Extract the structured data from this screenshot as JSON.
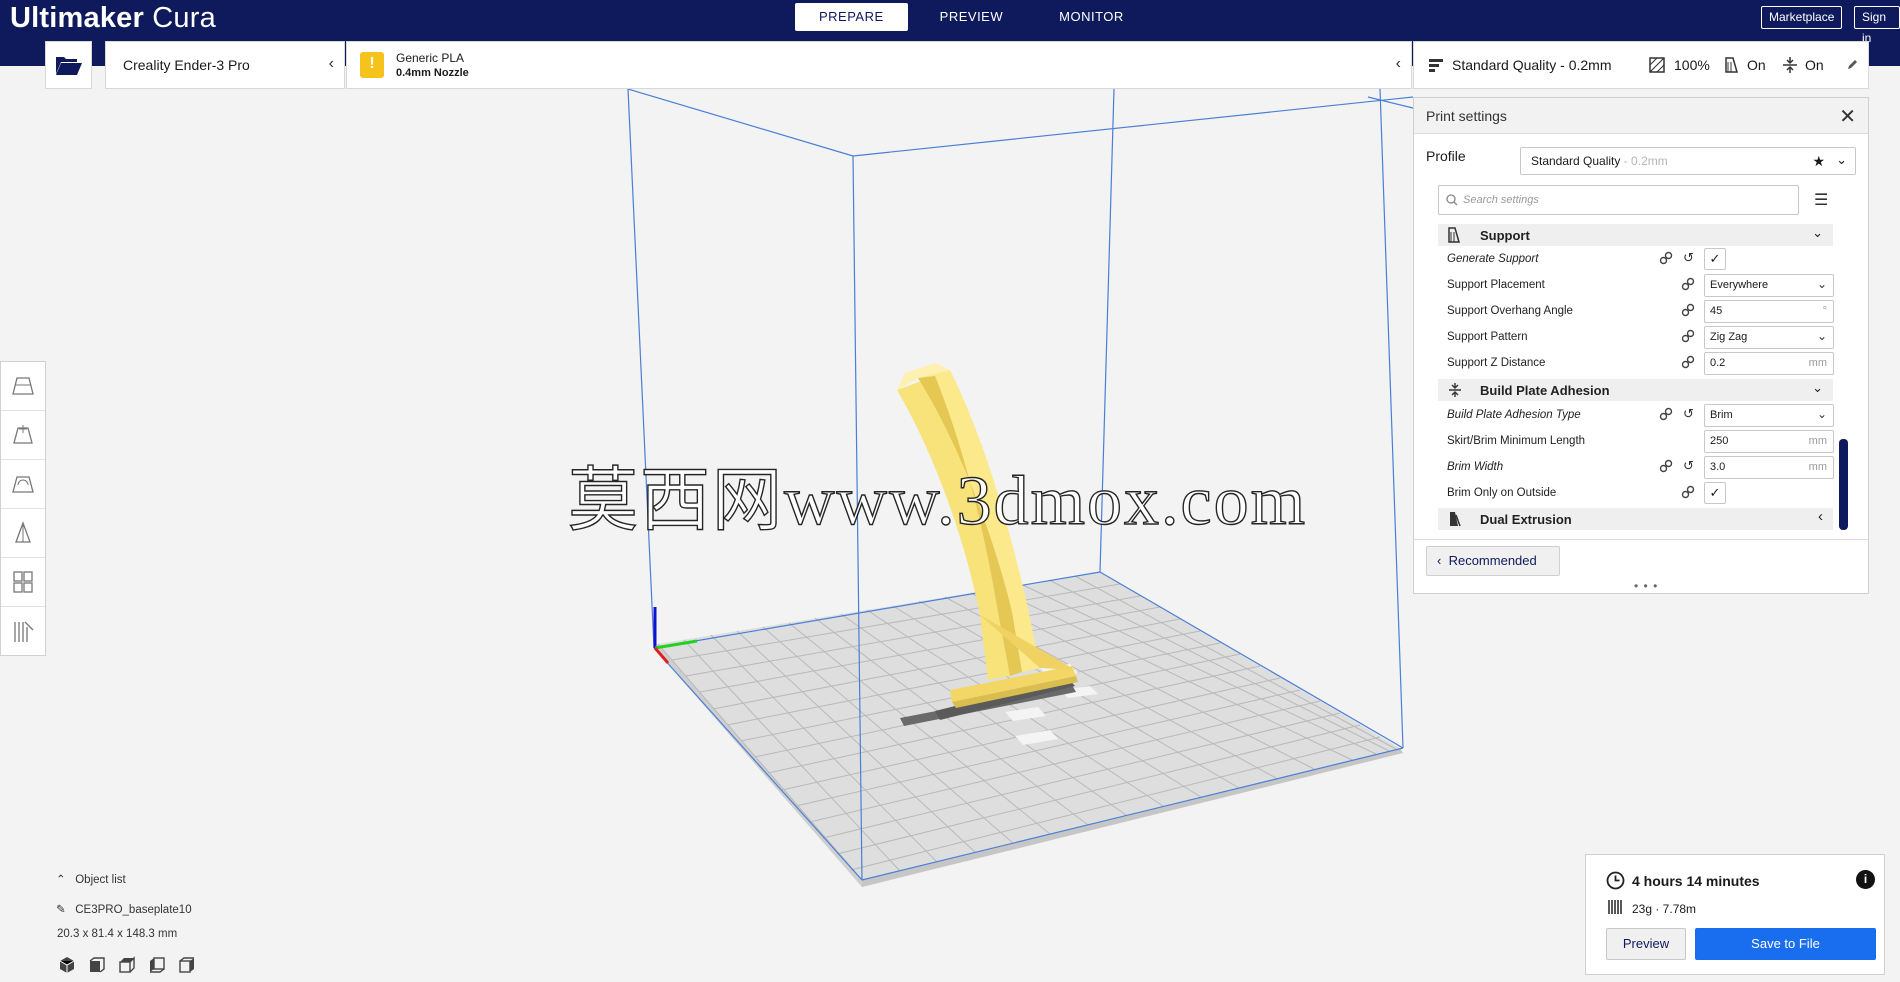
{
  "header": {
    "app_title_bold": "Ultimaker",
    "app_title_light": " Cura",
    "tabs": [
      {
        "label": "PREPARE"
      },
      {
        "label": "PREVIEW"
      },
      {
        "label": "MONITOR"
      }
    ],
    "marketplace_label": "Marketplace",
    "signin_label": "Sign in"
  },
  "printer": {
    "name": "Creality Ender-3 Pro"
  },
  "material": {
    "name": "Generic PLA",
    "nozzle": "0.4mm Nozzle",
    "warning_glyph": "!"
  },
  "print_setup": {
    "quality": "Standard Quality - 0.2mm",
    "infill": "100%",
    "support": "On",
    "adhesion": "On"
  },
  "settings_panel": {
    "title": "Print settings",
    "profile_label": "Profile",
    "profile_value": "Standard Quality",
    "profile_value_dim": " - 0.2mm",
    "search_placeholder": "Search settings",
    "categories": [
      {
        "label": "Support"
      },
      {
        "label": "Build Plate Adhesion"
      },
      {
        "label": "Dual Extrusion"
      }
    ],
    "rows": [
      {
        "label": "Generate Support",
        "value": "",
        "unit": ""
      },
      {
        "label": "Support Placement",
        "value": "Everywhere",
        "unit": ""
      },
      {
        "label": "Support Overhang Angle",
        "value": "45",
        "unit": "°"
      },
      {
        "label": "Support Pattern",
        "value": "Zig Zag",
        "unit": ""
      },
      {
        "label": "Support Z Distance",
        "value": "0.2",
        "unit": "mm"
      },
      {
        "label": "Build Plate Adhesion Type",
        "value": "Brim",
        "unit": ""
      },
      {
        "label": "Skirt/Brim Minimum Length",
        "value": "250",
        "unit": "mm"
      },
      {
        "label": "Brim Width",
        "value": "3.0",
        "unit": "mm"
      },
      {
        "label": "Brim Only on Outside",
        "value": "",
        "unit": ""
      }
    ],
    "recommended_label": "Recommended",
    "grip": "• • •"
  },
  "watermark": "莫西网www.3dmox.com",
  "object_list": {
    "toggle_label": "Object list",
    "object_name": "CE3PRO_baseplate10",
    "dimensions": "20.3 x 81.4 x 148.3 mm"
  },
  "job": {
    "time": "4 hours 14 minutes",
    "material_usage": "23g · 7.78m",
    "preview_label": "Preview",
    "save_label": "Save to File"
  },
  "colors": {
    "header_bg": "#0f1a5c",
    "accent_blue": "#196ef0",
    "model_yellow": "#f8e27a",
    "warning_yellow": "#f6c31d"
  }
}
